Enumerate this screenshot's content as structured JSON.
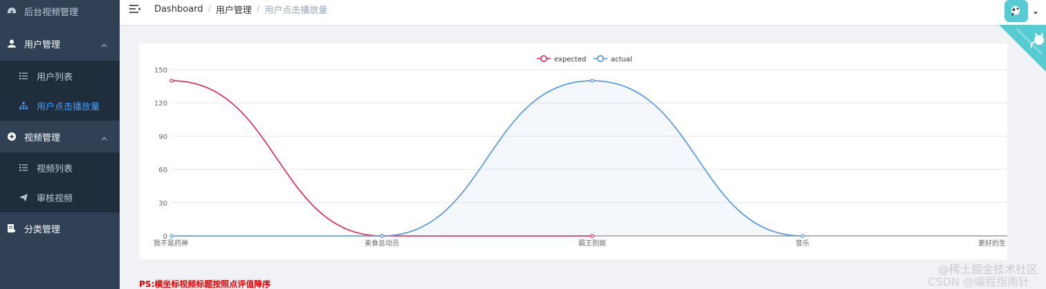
{
  "sidebar": {
    "items": [
      {
        "label": "后台视频管理",
        "icon": "dashboard-icon"
      },
      {
        "label": "用户管理",
        "icon": "user-icon"
      },
      {
        "label": "用户列表",
        "icon": "list-icon"
      },
      {
        "label": "用户点击播放量",
        "icon": "tree-icon"
      },
      {
        "label": "视频管理",
        "icon": "plus-circle-icon"
      },
      {
        "label": "视频列表",
        "icon": "list-icon"
      },
      {
        "label": "审核视频",
        "icon": "send-icon"
      },
      {
        "label": "分类管理",
        "icon": "doc-icon"
      }
    ]
  },
  "breadcrumb": [
    "Dashboard",
    "用户管理",
    "用户点击播放量"
  ],
  "chart_data": {
    "type": "line",
    "categories": [
      "我不是药神",
      "美食总动员",
      "霸王别姬",
      "音乐",
      "更好的生"
    ],
    "category_labels_shown": [
      "我不是药神",
      "美食总动员",
      "霸王别姬",
      "音乐",
      "更好的生"
    ],
    "series": [
      {
        "name": "expected",
        "values": [
          140,
          0,
          0
        ],
        "color": "#e01f54"
      },
      {
        "name": "actual",
        "values": [
          0,
          0,
          140,
          0
        ],
        "color": "#4a90e2"
      }
    ],
    "ylim": [
      0,
      150
    ],
    "yticks": [
      0,
      30,
      60,
      90,
      120,
      150
    ],
    "legend_position": "top-center",
    "grid": true,
    "smooth": true
  },
  "note": "PS:横坐标视频标题按照点评值降序",
  "watermark": {
    "line1": "@稀土掘金技术社区",
    "line2": "CSDN @编程指南针"
  },
  "colors": {
    "sidebar_bg": "#304156",
    "submenu_bg": "#1f2d3d",
    "active": "#409eff",
    "corner": "#56cbd1"
  }
}
